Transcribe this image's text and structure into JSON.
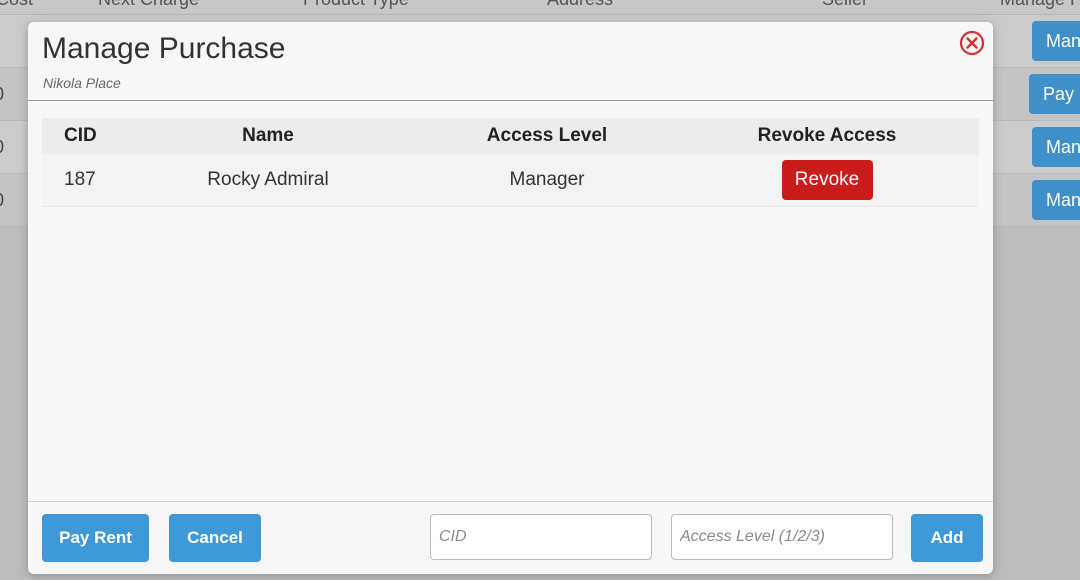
{
  "background": {
    "columns": [
      "Cost",
      "Next Charge",
      "Product Type",
      "Address",
      "Seller",
      "Manage Purchase"
    ],
    "rows": [
      {
        "value": "",
        "button": "Manage"
      },
      {
        "value": "0",
        "button": "Pay Rent"
      },
      {
        "value": "0",
        "button": "Manage"
      },
      {
        "value": "0",
        "button": "Manage"
      }
    ]
  },
  "modal": {
    "title": "Manage Purchase",
    "subtitle": "Nikola Place",
    "close_icon": "close-circle-icon",
    "table": {
      "headers": [
        "CID",
        "Name",
        "Access Level",
        "Revoke Access"
      ],
      "rows": [
        {
          "cid": "187",
          "name": "Rocky Admiral",
          "access": "Manager",
          "action": "Revoke"
        }
      ]
    },
    "footer": {
      "pay_rent": "Pay Rent",
      "cancel": "Cancel",
      "cid_placeholder": "CID",
      "access_placeholder": "Access Level (1/2/3)",
      "add": "Add"
    }
  },
  "colors": {
    "primary": "#3f98d8",
    "danger": "#cc1b1b",
    "close": "#d32f2f"
  }
}
